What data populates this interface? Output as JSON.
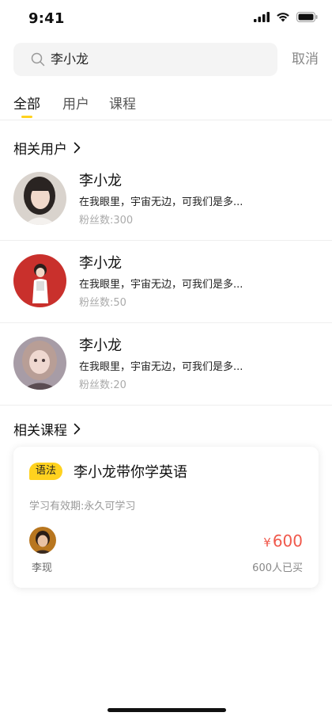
{
  "status_bar": {
    "time": "9:41",
    "icons": [
      "signal-icon",
      "wifi-icon",
      "battery-icon"
    ]
  },
  "search": {
    "query": "李小龙",
    "icon": "search-icon",
    "cancel_label": "取消"
  },
  "tabs": [
    {
      "label": "全部",
      "active": true
    },
    {
      "label": "用户",
      "active": false
    },
    {
      "label": "课程",
      "active": false
    }
  ],
  "users_section": {
    "title": "相关用户",
    "icon": "chevron-right-icon",
    "items": [
      {
        "name": "李小龙",
        "bio": "在我眼里，宇宙无边，可我们是多...",
        "fans": "粉丝数:300"
      },
      {
        "name": "李小龙",
        "bio": "在我眼里，宇宙无边，可我们是多...",
        "fans": "粉丝数:50"
      },
      {
        "name": "李小龙",
        "bio": "在我眼里，宇宙无边，可我们是多...",
        "fans": "粉丝数:20"
      }
    ]
  },
  "courses_section": {
    "title": "相关课程",
    "icon": "chevron-right-icon",
    "items": [
      {
        "tag": "语法",
        "title": "李小龙带你学英语",
        "validity": "学习有效期:永久可学习",
        "teacher": "李现",
        "price_symbol": "¥",
        "price": "600",
        "purchased": "600人已买"
      }
    ]
  },
  "colors": {
    "accent": "#ffd21f",
    "price": "#f0584b",
    "muted": "#aaaaaa",
    "search_bg": "#f4f4f4"
  }
}
